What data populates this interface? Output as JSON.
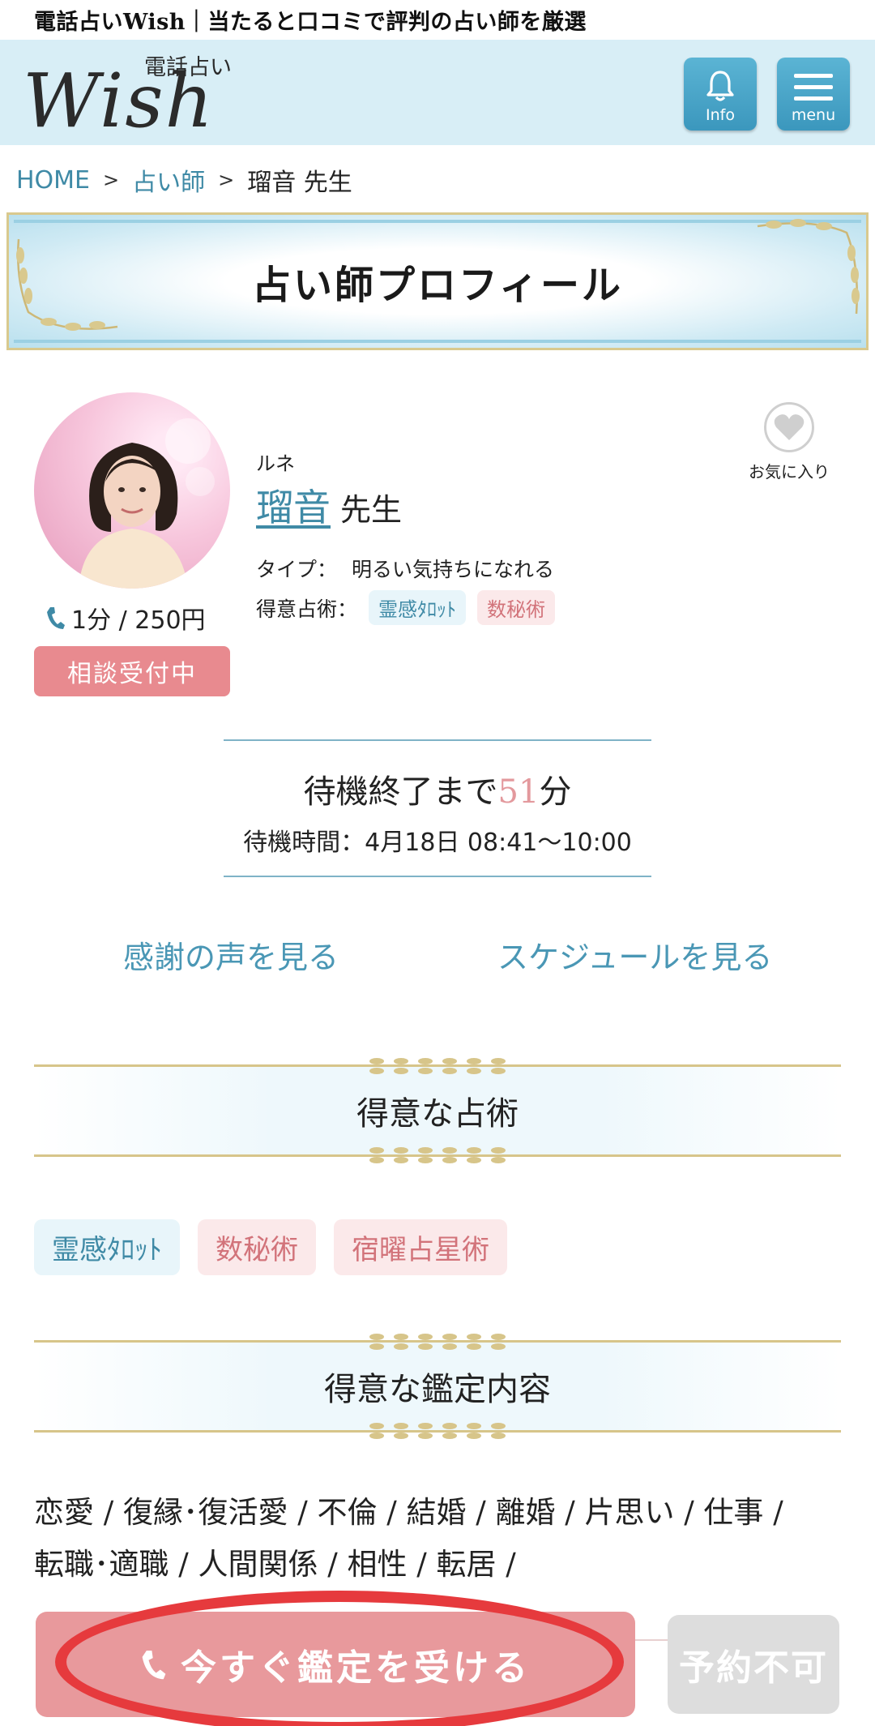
{
  "top_title": "電話占いWish｜当たると口コミで評判の占い師を厳選",
  "header": {
    "logo_sub": "電話占い",
    "logo_main": "Wish",
    "info_label": "Info",
    "menu_label": "menu"
  },
  "breadcrumb": {
    "home": "HOME",
    "category": "占い師",
    "current": "瑠音  先生",
    "separator": ">"
  },
  "banner_title": "占い師プロフィール",
  "profile": {
    "kana": "ルネ",
    "name": "瑠音",
    "honorific": "先生",
    "type_label": "タイプ：",
    "type_value": "明るい気持ちになれる",
    "skill_label": "得意占術：",
    "skills": [
      "霊感ﾀﾛｯﾄ",
      "数秘術"
    ],
    "price": "1分 / 250円",
    "status": "相談受付中",
    "favorite_label": "お気に入り"
  },
  "waiting": {
    "prefix": "待機終了まで",
    "minutes": "51",
    "suffix": "分",
    "time_text": "待機時間：4月18日 08:41〜10:00"
  },
  "links": {
    "voices": "感謝の声を見る",
    "schedule": "スケジュールを見る"
  },
  "section_skills": {
    "title": "得意な占術",
    "tags": [
      "霊感ﾀﾛｯﾄ",
      "数秘術",
      "宿曜占星術"
    ]
  },
  "section_content": {
    "title": "得意な鑑定内容",
    "line1": "恋愛 / 復縁･復活愛 / 不倫 / 結婚 / 離婚 / 片思い / 仕事 /",
    "line2": "転職･適職 / 人間関係 / 相性 / 転居 /"
  },
  "cta": {
    "call_now": "今すぐ鑑定を受ける",
    "reserve": "予約不可"
  },
  "colors": {
    "accent_blue": "#3f8aa6",
    "accent_pink": "#e8999c",
    "highlight_ring": "#e63a3d",
    "gold": "#d7c58a"
  }
}
